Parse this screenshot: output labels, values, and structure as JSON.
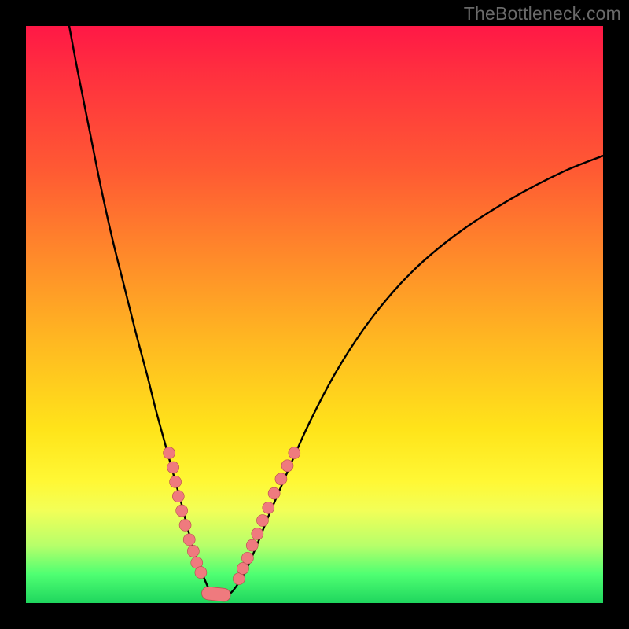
{
  "watermark": "TheBottleneck.com",
  "colors": {
    "gradient_top": "#ff1846",
    "gradient_mid": "#ffe41a",
    "gradient_bottom": "#1fd65e",
    "curve": "#000000",
    "marker_fill": "#ef7a7e",
    "marker_stroke": "#b94a4f",
    "frame": "#000000"
  },
  "chart_data": {
    "type": "line",
    "title": "",
    "xlabel": "",
    "ylabel": "",
    "xlim": [
      0,
      100
    ],
    "ylim": [
      0,
      100
    ],
    "grid": false,
    "legend": null,
    "series": [
      {
        "name": "bottleneck-curve",
        "x": [
          7.5,
          9,
          11,
          13,
          15,
          17,
          19,
          21,
          22.5,
          24,
          25.5,
          27,
          28,
          29,
          30,
          31,
          31.7,
          32.7,
          34.5,
          36,
          38,
          40,
          42,
          45,
          49,
          54,
          60,
          67,
          75,
          84,
          93,
          100
        ],
        "y": [
          100,
          92,
          82,
          72,
          63,
          55,
          47,
          39.5,
          33.5,
          28,
          22.5,
          17,
          13,
          9.5,
          6.5,
          4,
          2.5,
          1.3,
          1.2,
          2.3,
          5.5,
          10,
          15,
          22,
          31,
          40.5,
          49.5,
          57.5,
          64.2,
          70,
          74.7,
          77.5
        ]
      }
    ],
    "markers": {
      "left_branch": [
        {
          "x": 24.8,
          "y": 26.0
        },
        {
          "x": 25.5,
          "y": 23.5
        },
        {
          "x": 25.9,
          "y": 21.0
        },
        {
          "x": 26.4,
          "y": 18.5
        },
        {
          "x": 27.0,
          "y": 16.0
        },
        {
          "x": 27.6,
          "y": 13.5
        },
        {
          "x": 28.3,
          "y": 11.0
        },
        {
          "x": 29.0,
          "y": 9.0
        },
        {
          "x": 29.6,
          "y": 7.0
        },
        {
          "x": 30.3,
          "y": 5.3
        }
      ],
      "bottom": [
        {
          "x": 31.6,
          "y": 1.7
        },
        {
          "x": 32.5,
          "y": 1.3
        },
        {
          "x": 33.4,
          "y": 1.2
        },
        {
          "x": 34.3,
          "y": 1.4
        }
      ],
      "right_branch": [
        {
          "x": 36.9,
          "y": 4.2
        },
        {
          "x": 37.6,
          "y": 6.0
        },
        {
          "x": 38.4,
          "y": 7.8
        },
        {
          "x": 39.2,
          "y": 10.0
        },
        {
          "x": 40.1,
          "y": 12.0
        },
        {
          "x": 41.0,
          "y": 14.3
        },
        {
          "x": 42.0,
          "y": 16.5
        },
        {
          "x": 43.0,
          "y": 19.0
        },
        {
          "x": 44.2,
          "y": 21.5
        },
        {
          "x": 45.3,
          "y": 23.8
        },
        {
          "x": 46.5,
          "y": 26.0
        }
      ]
    }
  }
}
